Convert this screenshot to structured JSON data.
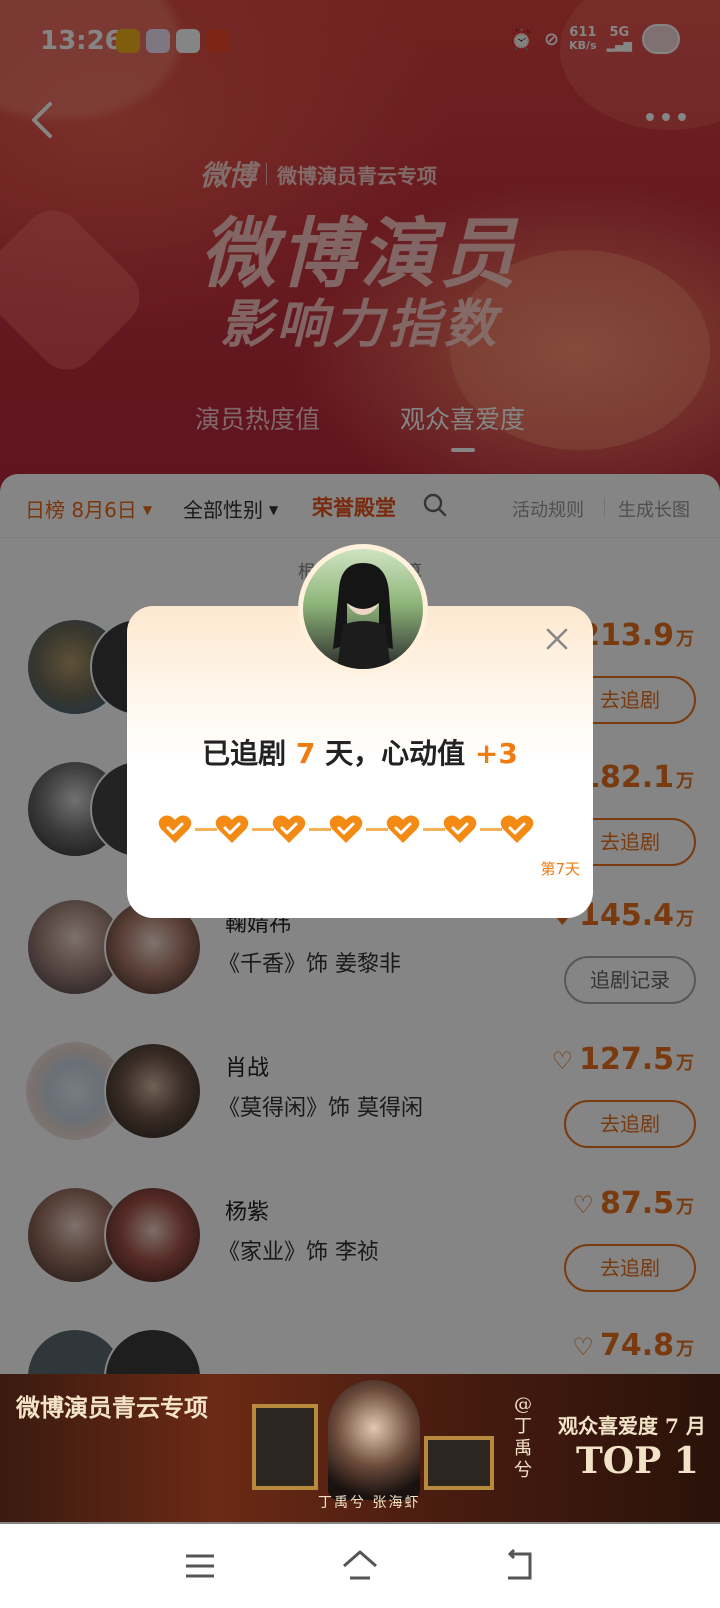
{
  "status": {
    "time": "13:26",
    "net_speed": "611",
    "net_unit": "KB/s",
    "network": "5G"
  },
  "header": {
    "brand": "微博",
    "brand_sub": "微博演员青云专项",
    "title_line1": "微博演员",
    "title_line2": "影响力指数",
    "tabs": [
      {
        "label": "演员热度值",
        "active": false
      },
      {
        "label": "观众喜爱度",
        "active": true
      }
    ]
  },
  "filters": {
    "date": "日榜 8月6日",
    "gender": "全部性别",
    "honor": "荣誉殿堂",
    "rules": "活动规则",
    "poster": "生成长图"
  },
  "note": "根据 2...据计算",
  "rows": [
    {
      "name": "",
      "role": "",
      "score": "213.9",
      "unit": "万",
      "button": "去追剧",
      "liked": false
    },
    {
      "name": "",
      "role": "",
      "score": "182.1",
      "unit": "万",
      "button": "去追剧",
      "liked": false
    },
    {
      "name": "鞠婧祎",
      "role": "《千香》饰 姜黎非",
      "score": "145.4",
      "unit": "万",
      "button": "追剧记录",
      "liked": true
    },
    {
      "name": "肖战",
      "role": "《莫得闲》饰 莫得闲",
      "score": "127.5",
      "unit": "万",
      "button": "去追剧",
      "liked": false
    },
    {
      "name": "杨紫",
      "role": "《家业》饰 李祯",
      "score": "87.5",
      "unit": "万",
      "button": "去追剧",
      "liked": false
    },
    {
      "name": "",
      "role": "",
      "score": "74.8",
      "unit": "万",
      "button": "",
      "liked": false
    }
  ],
  "dialog": {
    "prefix": "已追剧",
    "days": "7",
    "mid": "天，心动值",
    "bonus": "+3",
    "day_label": "第7天",
    "hearts_filled": 7
  },
  "ad": {
    "title": "微博演员青云专项",
    "tag": "@丁禹兮",
    "names": "丁禹兮  张海虾",
    "line1": "观众喜爱度 7 月",
    "line2": "TOP 1"
  },
  "colors": {
    "accent": "#e8701e",
    "hero_red": "#c42f3b",
    "honor": "#e8541e"
  }
}
